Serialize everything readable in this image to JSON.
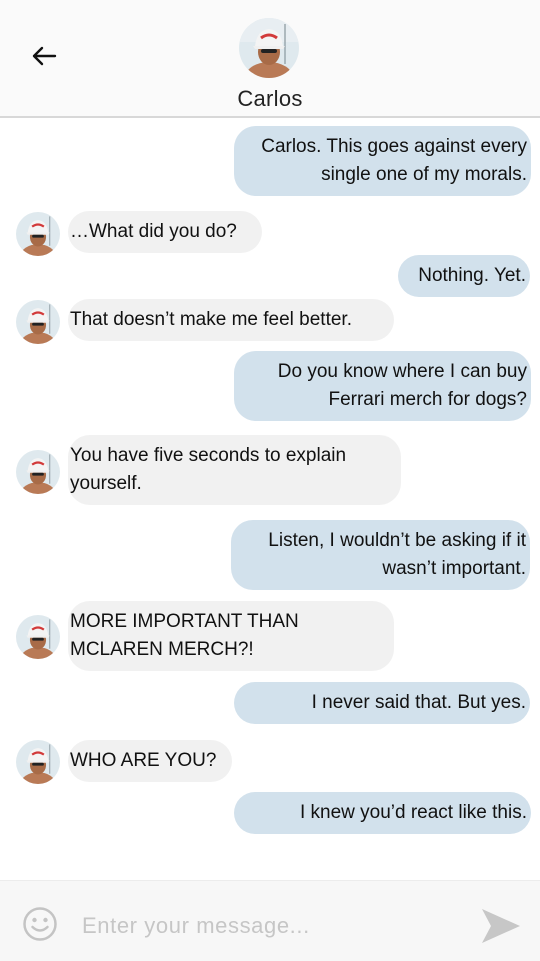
{
  "header": {
    "contact_name": "Carlos",
    "back_icon": "arrow-left-icon",
    "avatar_icon": "contact-avatar"
  },
  "messages": [
    {
      "direction": "out",
      "lines": [
        "Carlos. This goes against every",
        "single one of my morals."
      ]
    },
    {
      "direction": "in",
      "lines": [
        "…What did you do?"
      ]
    },
    {
      "direction": "out",
      "lines": [
        "Nothing. Yet."
      ]
    },
    {
      "direction": "in",
      "lines": [
        "That doesn’t make me feel better."
      ]
    },
    {
      "direction": "out",
      "lines": [
        "Do you know where I can buy",
        "Ferrari merch for dogs?"
      ]
    },
    {
      "direction": "in",
      "lines": [
        "You have five seconds to explain",
        "yourself."
      ]
    },
    {
      "direction": "out",
      "lines": [
        "Listen, I wouldn’t be asking if it",
        "wasn’t important."
      ]
    },
    {
      "direction": "in",
      "lines": [
        "MORE IMPORTANT THAN",
        "MCLAREN MERCH?!"
      ]
    },
    {
      "direction": "out",
      "lines": [
        "I never said that. But yes."
      ]
    },
    {
      "direction": "in",
      "lines": [
        "WHO ARE YOU?"
      ]
    },
    {
      "direction": "out",
      "lines": [
        "I knew you’d react like this."
      ]
    }
  ],
  "composer": {
    "placeholder": "Enter your message...",
    "emoji_icon": "smiley-icon",
    "send_icon": "send-icon"
  },
  "colors": {
    "outgoing_bubble": "#d2e1ec",
    "incoming_bubble": "#f1f1f1",
    "header_bg": "#fafafa"
  }
}
